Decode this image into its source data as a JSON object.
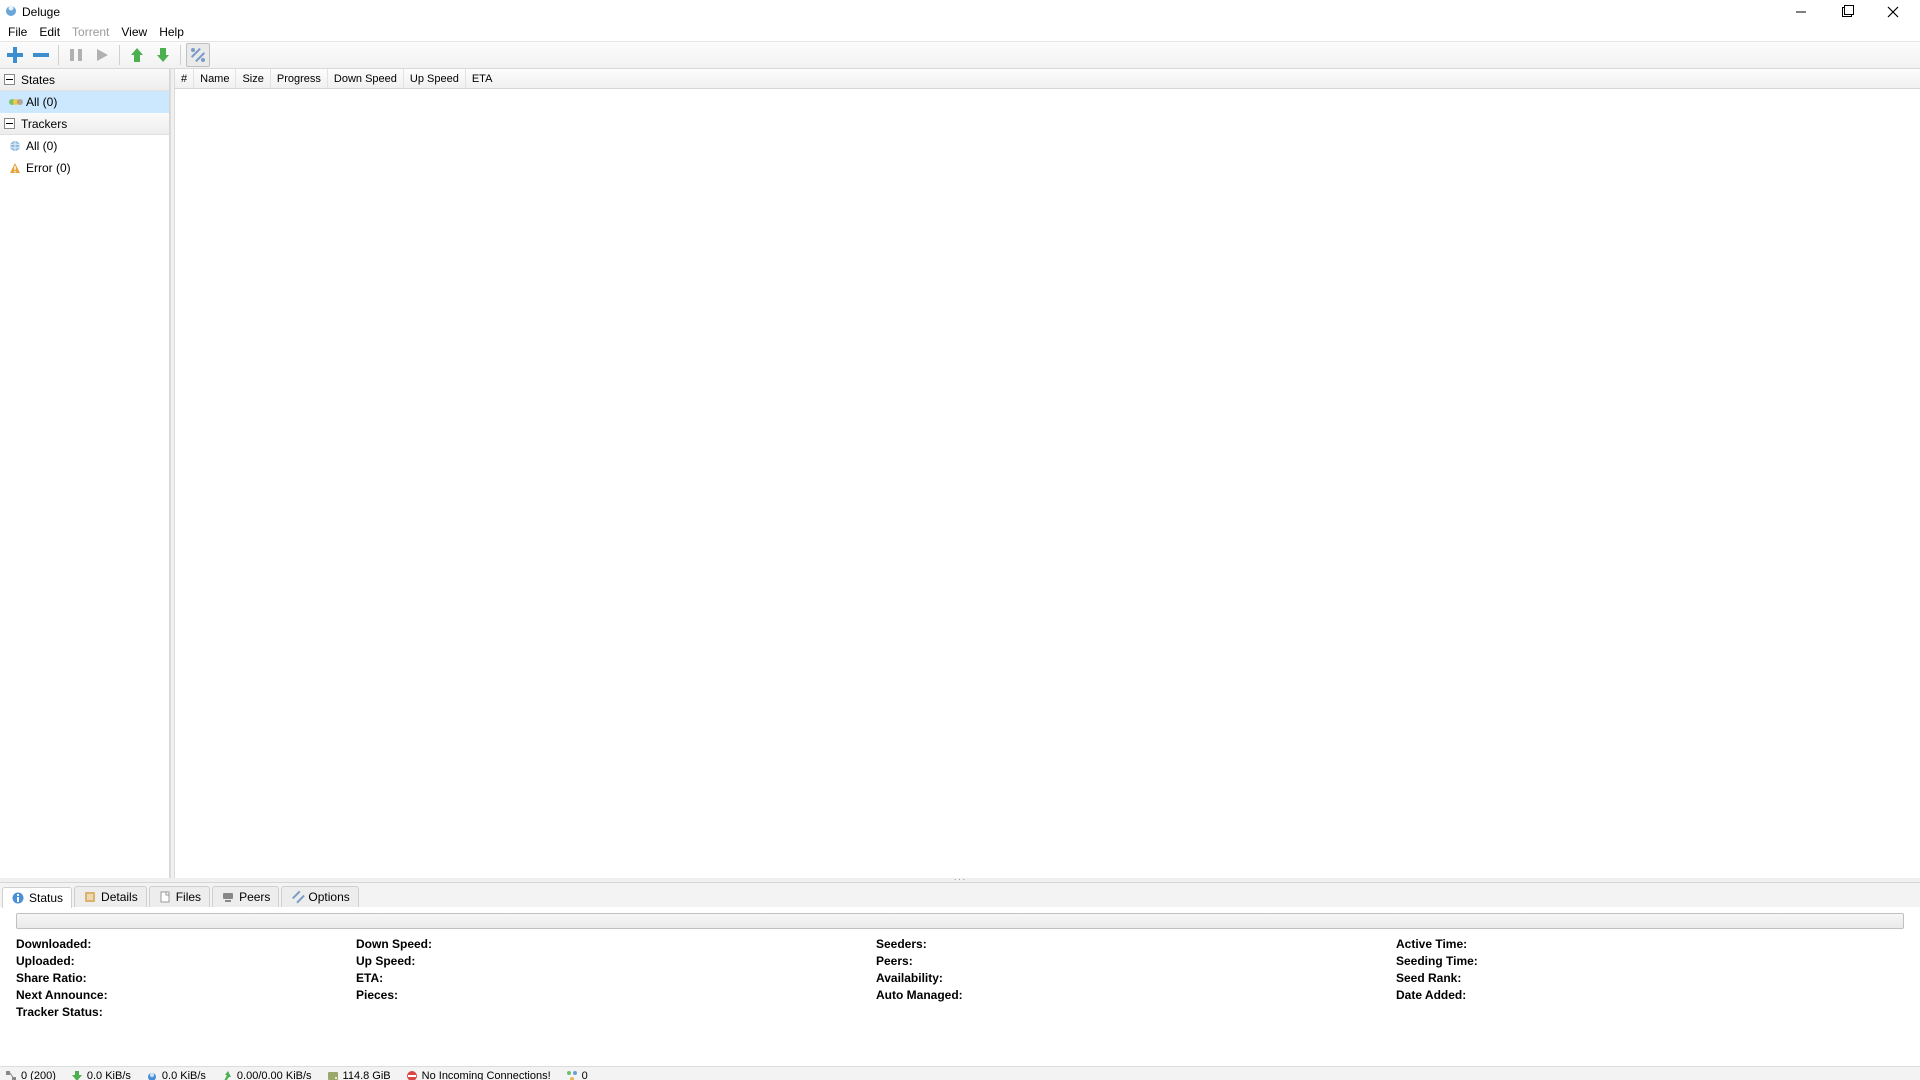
{
  "window": {
    "title": "Deluge"
  },
  "menu": {
    "file": "File",
    "edit": "Edit",
    "torrent": "Torrent",
    "view": "View",
    "help": "Help"
  },
  "sidebar": {
    "groups": [
      {
        "label": "States",
        "items": [
          {
            "label": "All (0)",
            "icon": "all",
            "selected": true
          }
        ]
      },
      {
        "label": "Trackers",
        "items": [
          {
            "label": "All (0)",
            "icon": "globe",
            "selected": false
          },
          {
            "label": "Error (0)",
            "icon": "error",
            "selected": false
          }
        ]
      }
    ]
  },
  "columns": [
    "#",
    "Name",
    "Size",
    "Progress",
    "Down Speed",
    "Up Speed",
    "ETA"
  ],
  "tabs": [
    {
      "label": "Status",
      "icon": "info",
      "active": true
    },
    {
      "label": "Details",
      "icon": "details",
      "active": false
    },
    {
      "label": "Files",
      "icon": "files",
      "active": false
    },
    {
      "label": "Peers",
      "icon": "peers",
      "active": false
    },
    {
      "label": "Options",
      "icon": "options",
      "active": false
    }
  ],
  "status_fields": {
    "col1": [
      "Downloaded:",
      "Uploaded:",
      "Share Ratio:",
      "Next Announce:",
      "Tracker Status:"
    ],
    "col2": [
      "Down Speed:",
      "Up Speed:",
      "ETA:",
      "Pieces:"
    ],
    "col3": [
      "Seeders:",
      "Peers:",
      "Availability:",
      "Auto Managed:"
    ],
    "col4": [
      "Active Time:",
      "Seeding Time:",
      "Seed Rank:",
      "Date Added:"
    ]
  },
  "statusbar": {
    "connections": "0 (200)",
    "down_speed": "0.0 KiB/s",
    "up_speed": "0.0 KiB/s",
    "protocol": "0.00/0.00 KiB/s",
    "disk": "114.8 GiB",
    "warning": "No Incoming Connections!",
    "dht": "0"
  }
}
